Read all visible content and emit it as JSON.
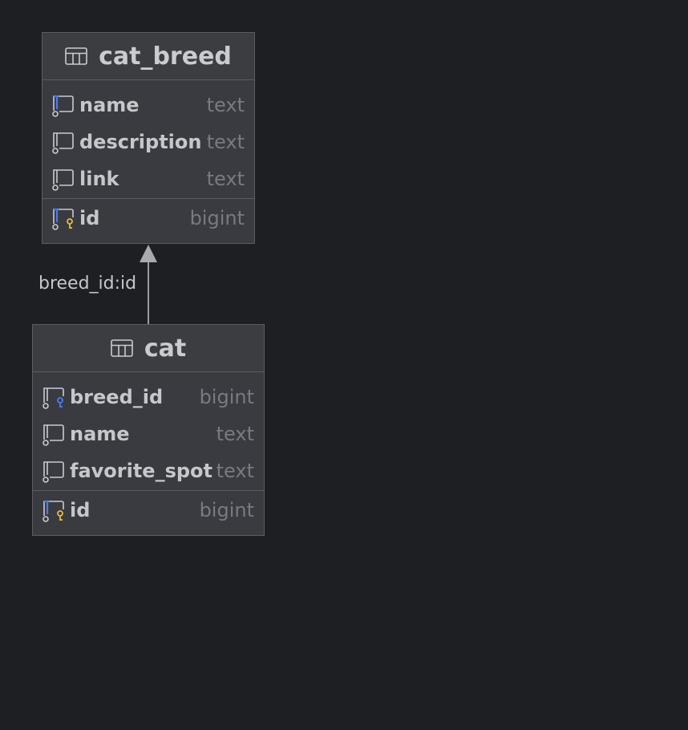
{
  "diagram": {
    "tables": [
      {
        "id": "cat_breed",
        "title": "cat_breed",
        "columns": [
          {
            "name": "name",
            "type": "text",
            "icon": "column-indexed-icon"
          },
          {
            "name": "description",
            "type": "text",
            "icon": "column-icon"
          },
          {
            "name": "link",
            "type": "text",
            "icon": "column-icon"
          }
        ],
        "primary_key": {
          "name": "id",
          "type": "bigint",
          "icon": "primary-key-column-icon"
        }
      },
      {
        "id": "cat",
        "title": "cat",
        "columns": [
          {
            "name": "breed_id",
            "type": "bigint",
            "icon": "foreign-key-column-icon"
          },
          {
            "name": "name",
            "type": "text",
            "icon": "column-icon"
          },
          {
            "name": "favorite_spot",
            "type": "text",
            "icon": "column-icon"
          }
        ],
        "primary_key": {
          "name": "id",
          "type": "bigint",
          "icon": "primary-key-column-icon"
        }
      }
    ],
    "relations": [
      {
        "from": "cat",
        "to": "cat_breed",
        "label": "breed_id:id"
      }
    ]
  },
  "colors": {
    "background": "#1e1f22",
    "table_fill": "#393b40",
    "border": "#5a5d63",
    "key_blue": "#4a7cf0",
    "key_yellow": "#e8b93c",
    "arrow": "#9a9ca1"
  }
}
